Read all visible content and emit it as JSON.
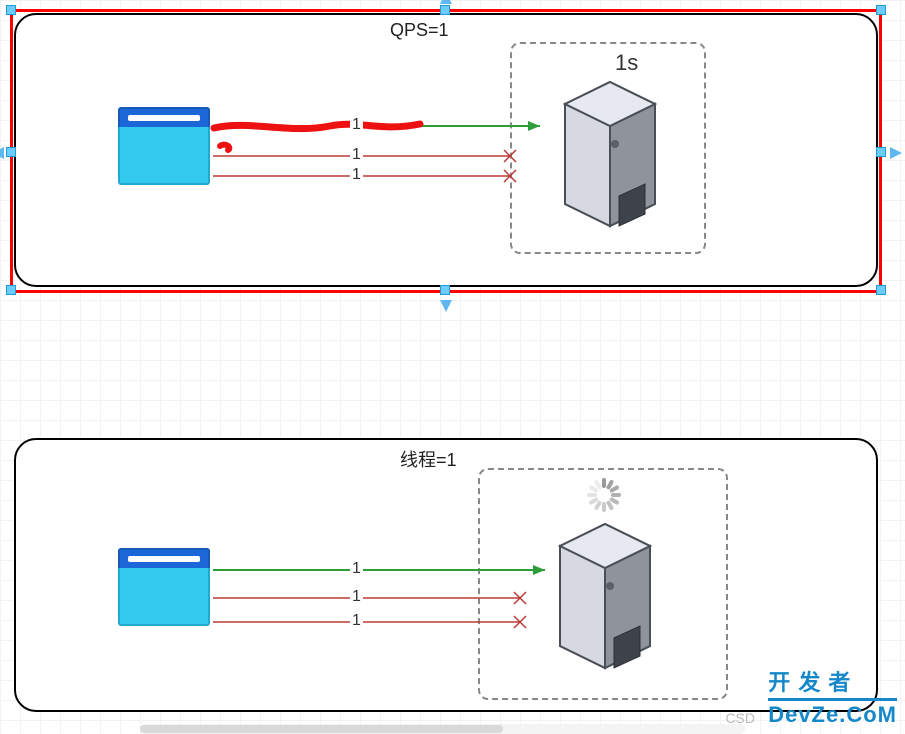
{
  "panel1": {
    "title": "QPS=1",
    "server_label": "1s",
    "flows": [
      {
        "label": "1",
        "status": "ok"
      },
      {
        "label": "1",
        "status": "blocked"
      },
      {
        "label": "1",
        "status": "blocked"
      }
    ]
  },
  "panel2": {
    "title": "线程=1",
    "flows": [
      {
        "label": "1",
        "status": "ok"
      },
      {
        "label": "1",
        "status": "blocked"
      },
      {
        "label": "1",
        "status": "blocked"
      }
    ]
  },
  "watermark_main_top": "开 发 者",
  "watermark_main_bottom": "DevZe.CoM",
  "watermark_prefix": "CSD",
  "colors": {
    "ok": "#2e9e3b",
    "blocked": "#bb3a36",
    "selection": "#ff0000",
    "handle": "#6ecbff"
  }
}
